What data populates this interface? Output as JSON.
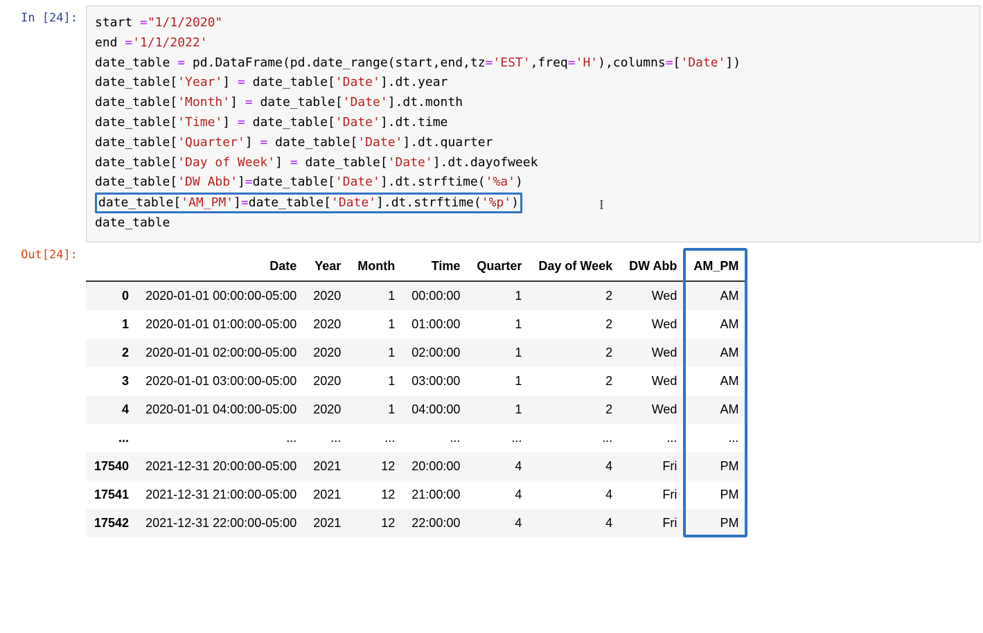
{
  "input": {
    "prompt": "In [24]:",
    "code_lines": [
      {
        "segments": [
          {
            "t": "start ",
            "c": ""
          },
          {
            "t": "=",
            "c": "tok-op"
          },
          {
            "t": "\"1/1/2020\"",
            "c": "tok-str"
          }
        ]
      },
      {
        "segments": [
          {
            "t": "end ",
            "c": ""
          },
          {
            "t": "=",
            "c": "tok-op"
          },
          {
            "t": "'1/1/2022'",
            "c": "tok-str"
          }
        ]
      },
      {
        "segments": [
          {
            "t": "date_table ",
            "c": ""
          },
          {
            "t": "=",
            "c": "tok-op"
          },
          {
            "t": " pd.DataFrame(pd.date_range(start,end,tz",
            "c": ""
          },
          {
            "t": "=",
            "c": "tok-op"
          },
          {
            "t": "'EST'",
            "c": "tok-str"
          },
          {
            "t": ",freq",
            "c": ""
          },
          {
            "t": "=",
            "c": "tok-op"
          },
          {
            "t": "'H'",
            "c": "tok-str"
          },
          {
            "t": "),columns",
            "c": ""
          },
          {
            "t": "=",
            "c": "tok-op"
          },
          {
            "t": "[",
            "c": ""
          },
          {
            "t": "'Date'",
            "c": "tok-str"
          },
          {
            "t": "])",
            "c": ""
          }
        ]
      },
      {
        "segments": [
          {
            "t": "date_table[",
            "c": ""
          },
          {
            "t": "'Year'",
            "c": "tok-str"
          },
          {
            "t": "] ",
            "c": ""
          },
          {
            "t": "=",
            "c": "tok-op"
          },
          {
            "t": " date_table[",
            "c": ""
          },
          {
            "t": "'Date'",
            "c": "tok-str"
          },
          {
            "t": "].dt.year",
            "c": ""
          }
        ]
      },
      {
        "segments": [
          {
            "t": "date_table[",
            "c": ""
          },
          {
            "t": "'Month'",
            "c": "tok-str"
          },
          {
            "t": "] ",
            "c": ""
          },
          {
            "t": "=",
            "c": "tok-op"
          },
          {
            "t": " date_table[",
            "c": ""
          },
          {
            "t": "'Date'",
            "c": "tok-str"
          },
          {
            "t": "].dt.month",
            "c": ""
          }
        ]
      },
      {
        "segments": [
          {
            "t": "date_table[",
            "c": ""
          },
          {
            "t": "'Time'",
            "c": "tok-str"
          },
          {
            "t": "] ",
            "c": ""
          },
          {
            "t": "=",
            "c": "tok-op"
          },
          {
            "t": " date_table[",
            "c": ""
          },
          {
            "t": "'Date'",
            "c": "tok-str"
          },
          {
            "t": "].dt.time",
            "c": ""
          }
        ]
      },
      {
        "segments": [
          {
            "t": "date_table[",
            "c": ""
          },
          {
            "t": "'Quarter'",
            "c": "tok-str"
          },
          {
            "t": "] ",
            "c": ""
          },
          {
            "t": "=",
            "c": "tok-op"
          },
          {
            "t": " date_table[",
            "c": ""
          },
          {
            "t": "'Date'",
            "c": "tok-str"
          },
          {
            "t": "].dt.quarter",
            "c": ""
          }
        ]
      },
      {
        "segments": [
          {
            "t": "date_table[",
            "c": ""
          },
          {
            "t": "'Day of Week'",
            "c": "tok-str"
          },
          {
            "t": "] ",
            "c": ""
          },
          {
            "t": "=",
            "c": "tok-op"
          },
          {
            "t": " date_table[",
            "c": ""
          },
          {
            "t": "'Date'",
            "c": "tok-str"
          },
          {
            "t": "].dt.dayofweek",
            "c": ""
          }
        ]
      },
      {
        "segments": [
          {
            "t": "date_table[",
            "c": ""
          },
          {
            "t": "'DW Abb'",
            "c": "tok-str"
          },
          {
            "t": "]",
            "c": ""
          },
          {
            "t": "=",
            "c": "tok-op"
          },
          {
            "t": "date_table[",
            "c": ""
          },
          {
            "t": "'Date'",
            "c": "tok-str"
          },
          {
            "t": "].dt.strftime(",
            "c": ""
          },
          {
            "t": "'%a'",
            "c": "tok-str"
          },
          {
            "t": ")",
            "c": ""
          }
        ]
      },
      {
        "highlight": true,
        "segments": [
          {
            "t": "date_table[",
            "c": ""
          },
          {
            "t": "'AM_PM'",
            "c": "tok-str"
          },
          {
            "t": "]",
            "c": ""
          },
          {
            "t": "=",
            "c": "tok-op"
          },
          {
            "t": "date_table[",
            "c": ""
          },
          {
            "t": "'Date'",
            "c": "tok-str"
          },
          {
            "t": "].dt.strftime(",
            "c": ""
          },
          {
            "t": "'%p'",
            "c": "tok-str"
          },
          {
            "t": ")",
            "c": ""
          }
        ]
      },
      {
        "segments": [
          {
            "t": "date_table",
            "c": ""
          }
        ]
      }
    ]
  },
  "output": {
    "prompt": "Out[24]:",
    "table": {
      "columns": [
        "Date",
        "Year",
        "Month",
        "Time",
        "Quarter",
        "Day of Week",
        "DW Abb",
        "AM_PM"
      ],
      "rows": [
        {
          "idx": "0",
          "cells": [
            "2020-01-01 00:00:00-05:00",
            "2020",
            "1",
            "00:00:00",
            "1",
            "2",
            "Wed",
            "AM"
          ]
        },
        {
          "idx": "1",
          "cells": [
            "2020-01-01 01:00:00-05:00",
            "2020",
            "1",
            "01:00:00",
            "1",
            "2",
            "Wed",
            "AM"
          ]
        },
        {
          "idx": "2",
          "cells": [
            "2020-01-01 02:00:00-05:00",
            "2020",
            "1",
            "02:00:00",
            "1",
            "2",
            "Wed",
            "AM"
          ]
        },
        {
          "idx": "3",
          "cells": [
            "2020-01-01 03:00:00-05:00",
            "2020",
            "1",
            "03:00:00",
            "1",
            "2",
            "Wed",
            "AM"
          ]
        },
        {
          "idx": "4",
          "cells": [
            "2020-01-01 04:00:00-05:00",
            "2020",
            "1",
            "04:00:00",
            "1",
            "2",
            "Wed",
            "AM"
          ]
        },
        {
          "idx": "...",
          "cells": [
            "...",
            "...",
            "...",
            "...",
            "...",
            "...",
            "...",
            "..."
          ]
        },
        {
          "idx": "17540",
          "cells": [
            "2021-12-31 20:00:00-05:00",
            "2021",
            "12",
            "20:00:00",
            "4",
            "4",
            "Fri",
            "PM"
          ]
        },
        {
          "idx": "17541",
          "cells": [
            "2021-12-31 21:00:00-05:00",
            "2021",
            "12",
            "21:00:00",
            "4",
            "4",
            "Fri",
            "PM"
          ]
        },
        {
          "idx": "17542",
          "cells": [
            "2021-12-31 22:00:00-05:00",
            "2021",
            "12",
            "22:00:00",
            "4",
            "4",
            "Fri",
            "PM"
          ]
        }
      ]
    }
  }
}
